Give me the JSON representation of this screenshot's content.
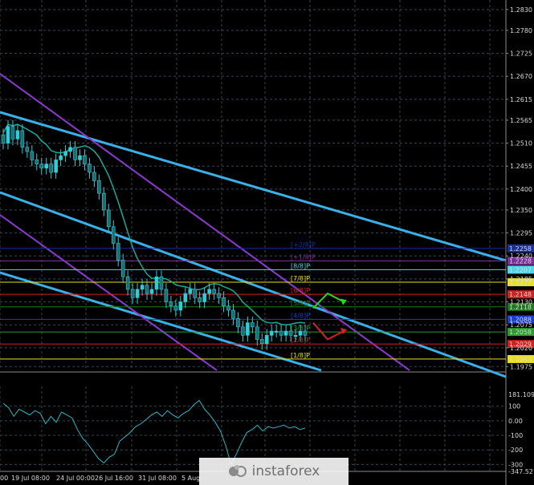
{
  "chart_data": {
    "type": "candlestick",
    "price_axis": {
      "range": [
        1.1966,
        1.2845
      ],
      "ticks": [
        "1.2830",
        "1.2780",
        "1.2725",
        "1.2670",
        "1.2615",
        "1.2565",
        "1.2510",
        "1.2455",
        "1.2400",
        "1.2350",
        "1.2295",
        "1.2240",
        "1.2185",
        "1.2130",
        "1.2075",
        "1.2020",
        "1.1975"
      ]
    },
    "x_axis": {
      "labels": [
        "19 Jul 08:00",
        "24 Jul 00:00",
        "26 Jul 16:00",
        "31 Jul 08:00",
        "5 Aug"
      ]
    },
    "murrey_levels": [
      {
        "label": "[+2/8]P",
        "price": 1.2258,
        "color": "#1a2fa0",
        "tag": "1.2258"
      },
      {
        "label": "[+1/8]P",
        "price": 1.2228,
        "color": "#7b2f9a",
        "tag": "1.2228"
      },
      {
        "label": "[8/8]P",
        "price": 1.2207,
        "color": "#4fd6e6",
        "tag": "1.2207"
      },
      {
        "label": "[7/8]P",
        "price": 1.2177,
        "color": "#e8e020",
        "tag": "1.2177"
      },
      {
        "label": "[6/8]P",
        "price": 1.2148,
        "color": "#d42020",
        "tag": "1.2148"
      },
      {
        "label": "[5/8]P",
        "price": 1.2118,
        "color": "#1f7a1f",
        "tag": "1.2118"
      },
      {
        "label": "[4/8]P",
        "price": 1.2088,
        "color": "#1a3fd0",
        "tag": "1.2088"
      },
      {
        "label": "[3/8]P",
        "price": 1.2058,
        "color": "#2f9a2f",
        "tag": "1.2058"
      },
      {
        "label": "[2/8]P",
        "price": 1.2029,
        "color": "#d42020",
        "tag": "1.2029"
      },
      {
        "label": "[1/8]P",
        "price": 1.1993,
        "color": "#e8e020",
        "tag": "1.1993"
      }
    ],
    "oscillator": {
      "range": [
        -347.527,
        181.1091
      ],
      "ticks": [
        "181.1091",
        "100",
        "0.00",
        "-100",
        "-200",
        "-300",
        "-347.527"
      ],
      "values": [
        120,
        90,
        30,
        80,
        60,
        40,
        70,
        50,
        -20,
        30,
        -10,
        60,
        40,
        20,
        -60,
        -120,
        -160,
        -210,
        -260,
        -290,
        -250,
        -230,
        -140,
        -110,
        -80,
        -40,
        -20,
        10,
        40,
        60,
        30,
        70,
        40,
        20,
        50,
        70,
        110,
        140,
        80,
        40,
        -10,
        -70,
        -170,
        -300,
        -230,
        -150,
        -80,
        -60,
        -30,
        -70,
        -40,
        -50,
        -40,
        -30,
        -50,
        -40,
        -60,
        -50
      ]
    },
    "candles_close": [
      1.251,
      1.255,
      1.252,
      1.254,
      1.25,
      1.249,
      1.247,
      1.246,
      1.245,
      1.246,
      1.244,
      1.247,
      1.248,
      1.249,
      1.25,
      1.247,
      1.248,
      1.246,
      1.244,
      1.242,
      1.239,
      1.235,
      1.231,
      1.227,
      1.223,
      1.219,
      1.216,
      1.214,
      1.216,
      1.217,
      1.215,
      1.216,
      1.219,
      1.216,
      1.213,
      1.212,
      1.211,
      1.213,
      1.215,
      1.216,
      1.214,
      1.213,
      1.215,
      1.216,
      1.215,
      1.214,
      1.212,
      1.211,
      1.209,
      1.207,
      1.205,
      1.208,
      1.207,
      1.204,
      1.203,
      1.205,
      1.206,
      1.206,
      1.205,
      1.206,
      1.205,
      1.205,
      1.206,
      1.205
    ],
    "forecast": [
      {
        "color": "#22dd22",
        "points": [
          [
            1.2115,
            0
          ],
          [
            1.215,
            0
          ],
          [
            1.213,
            0
          ]
        ]
      },
      {
        "color": "#e02020",
        "points": [
          [
            1.208,
            0
          ],
          [
            1.204,
            0
          ],
          [
            1.206,
            0
          ]
        ]
      }
    ]
  },
  "watermark": {
    "text": "instaforex"
  }
}
